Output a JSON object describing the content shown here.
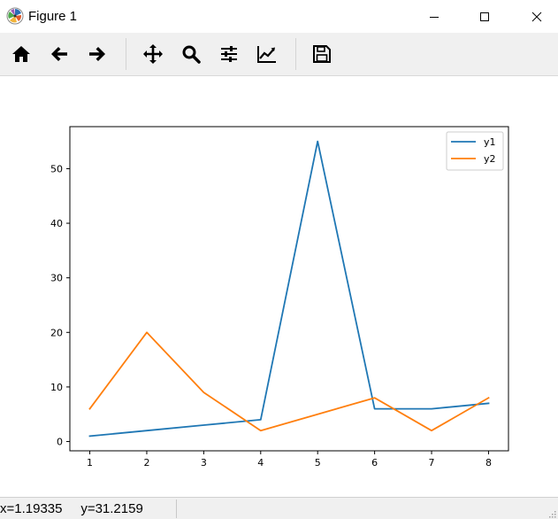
{
  "window": {
    "title": "Figure 1",
    "icon": "matplotlib-icon",
    "controls": [
      "minimize-icon",
      "maximize-icon",
      "close-icon"
    ]
  },
  "toolbar": {
    "items": [
      {
        "name": "home-button",
        "icon": "home-icon"
      },
      {
        "name": "back-button",
        "icon": "arrow-left-icon"
      },
      {
        "name": "forward-button",
        "icon": "arrow-right-icon"
      },
      {
        "name": "pan-button",
        "icon": "move-icon"
      },
      {
        "name": "zoom-button",
        "icon": "magnifier-icon"
      },
      {
        "name": "subplots-button",
        "icon": "sliders-icon"
      },
      {
        "name": "customize-button",
        "icon": "chart-line-icon"
      },
      {
        "name": "save-button",
        "icon": "floppy-disk-icon"
      }
    ]
  },
  "status": {
    "text": "x=1.19335     y=31.2159"
  },
  "chart_data": {
    "type": "line",
    "x": [
      1,
      2,
      3,
      4,
      5,
      6,
      7,
      8
    ],
    "series": [
      {
        "name": "y1",
        "color": "#1f77b4",
        "values": [
          1,
          2,
          3,
          4,
          55,
          6,
          6,
          7
        ]
      },
      {
        "name": "y2",
        "color": "#ff7f0e",
        "values": [
          6,
          20,
          9,
          2,
          5,
          8,
          2,
          8
        ]
      }
    ],
    "xlim": [
      0.65,
      8.35
    ],
    "ylim": [
      -1.7,
      57.7
    ],
    "xticks": [
      1,
      2,
      3,
      4,
      5,
      6,
      7,
      8
    ],
    "yticks": [
      0,
      10,
      20,
      30,
      40,
      50
    ],
    "grid": false,
    "legend_position": "upper right",
    "title": "",
    "xlabel": "",
    "ylabel": ""
  }
}
